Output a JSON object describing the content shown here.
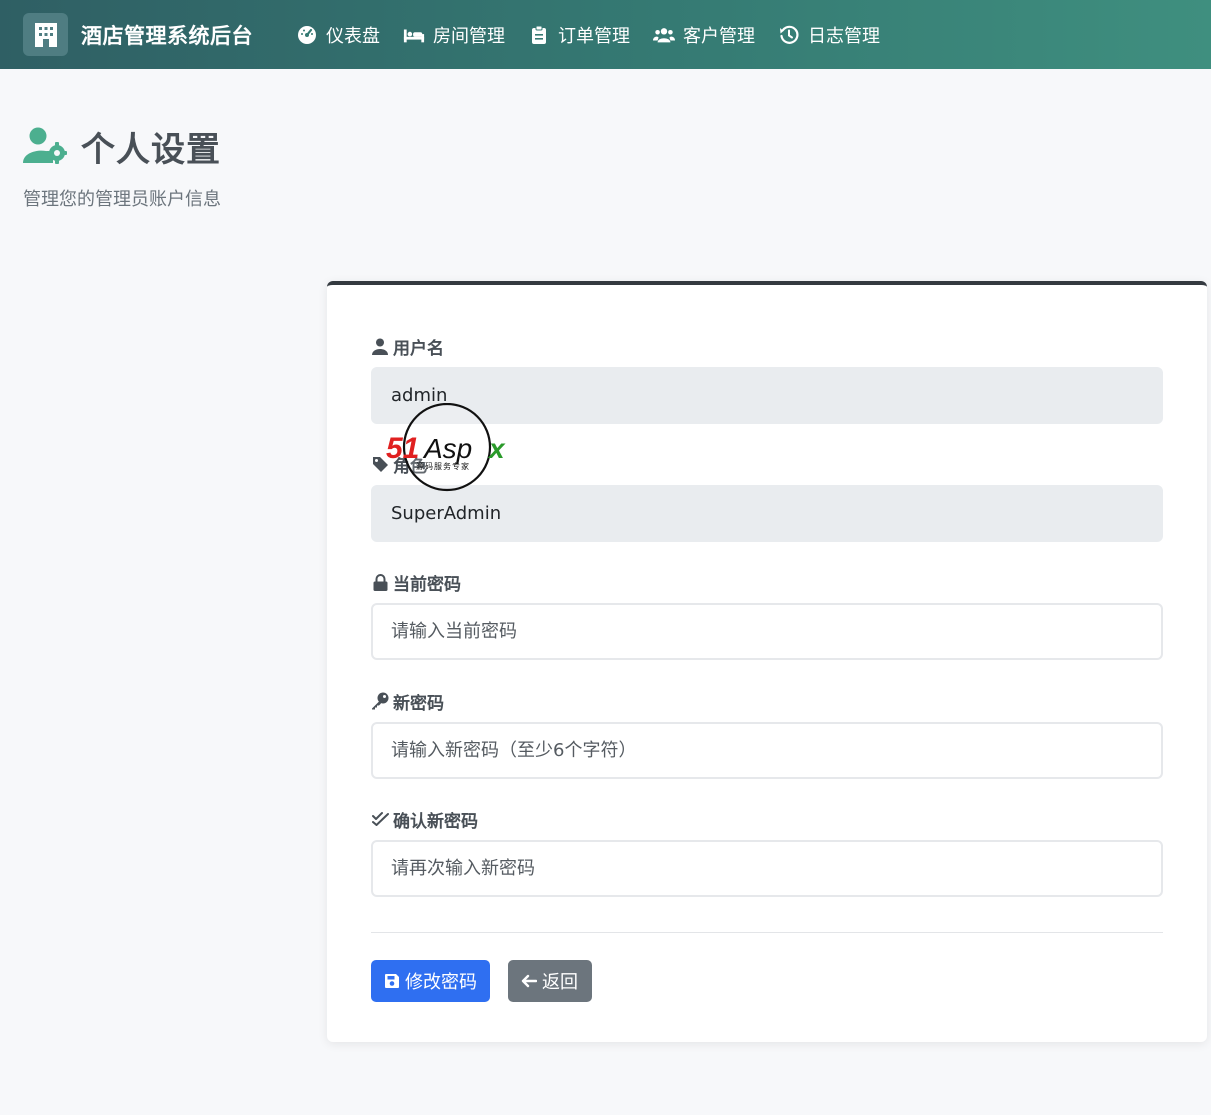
{
  "app": {
    "title": "酒店管理系统后台"
  },
  "nav": {
    "items": [
      {
        "label": "仪表盘",
        "icon": "dashboard-gauge-icon"
      },
      {
        "label": "房间管理",
        "icon": "bed-icon"
      },
      {
        "label": "订单管理",
        "icon": "clipboard-icon"
      },
      {
        "label": "客户管理",
        "icon": "users-icon"
      },
      {
        "label": "日志管理",
        "icon": "history-icon"
      }
    ]
  },
  "page": {
    "title": "个人设置",
    "subtitle": "管理您的管理员账户信息",
    "icon": "user-gear-icon"
  },
  "form": {
    "username": {
      "label": "用户名",
      "value": "admin",
      "icon": "user-icon"
    },
    "role": {
      "label": "角色",
      "value": "SuperAdmin",
      "icon": "tag-icon"
    },
    "current_password": {
      "label": "当前密码",
      "placeholder": "请输入当前密码",
      "icon": "lock-icon"
    },
    "new_password": {
      "label": "新密码",
      "placeholder": "请输入新密码（至少6个字符）",
      "icon": "key-icon"
    },
    "confirm_password": {
      "label": "确认新密码",
      "placeholder": "请再次输入新密码",
      "icon": "double-check-icon"
    },
    "submit_label": "修改密码",
    "back_label": "返回"
  },
  "watermark": {
    "brand": "51Aspx",
    "tagline": "源码服务专家"
  },
  "colors": {
    "navbar_start": "#2f5f64",
    "navbar_end": "#3f8f7f",
    "accent_green": "#4caf8f",
    "primary": "#2f6ff1",
    "secondary": "#6c757d",
    "card_top_border": "#343a40"
  }
}
